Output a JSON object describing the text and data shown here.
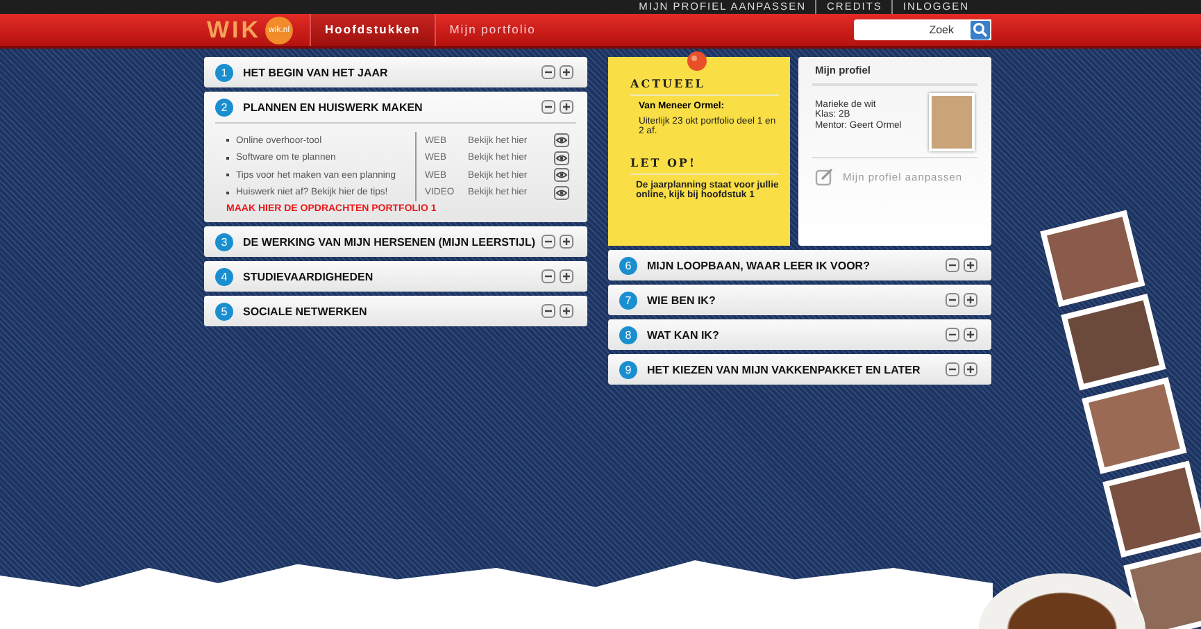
{
  "top_links": [
    "MIJN PROFIEL AANPASSEN",
    "CREDITS",
    "INLOGGEN"
  ],
  "logo": {
    "text": "WIK",
    "badge": "wik.nl"
  },
  "nav": [
    {
      "label": "Hoofdstukken",
      "selected": true
    },
    {
      "label": "Mijn portfolio",
      "selected": false
    }
  ],
  "search": {
    "placeholder": "Zoek"
  },
  "chapters_left": [
    {
      "number": "1",
      "title": "HET BEGIN VAN HET JAAR"
    },
    {
      "number": "2",
      "title": "PLANNEN EN HUISWERK MAKEN",
      "items": [
        {
          "text": "Online overhoor-tool",
          "type": "WEB",
          "link": "Bekijk het hier"
        },
        {
          "text": "Software om te plannen",
          "type": "WEB",
          "link": "Bekijk het hier"
        },
        {
          "text": "Tips voor het maken van een planning",
          "type": "WEB",
          "link": "Bekijk het hier"
        },
        {
          "text": "Huiswerk niet af? Bekijk hier de tips!",
          "type": "VIDEO",
          "link": "Bekijk het hier"
        }
      ],
      "assignment": "MAAK HIER DE OPDRACHTEN PORTFOLIO 1"
    },
    {
      "number": "3",
      "title": "DE WERKING VAN MIJN HERSENEN (MIJN LEERSTIJL)"
    },
    {
      "number": "4",
      "title": "STUDIEVAARDIGHEDEN"
    },
    {
      "number": "5",
      "title": "SOCIALE NETWERKEN"
    }
  ],
  "note": {
    "sections": [
      {
        "heading": "ACTUEEL",
        "subheading": "Van Meneer Ormel:",
        "text": "Uiterlijk 23 okt portfolio deel 1 en 2 af."
      },
      {
        "heading": "LET OP!",
        "text": "De jaarplanning staat voor jullie online, kijk bij hoofdstuk 1"
      }
    ]
  },
  "profile": {
    "title": "Mijn profiel",
    "lines": [
      "Marieke de wit",
      "Klas: 2B",
      "Mentor: Geert Ormel"
    ],
    "edit_link": "Mijn profiel aanpassen"
  },
  "chapters_right": [
    {
      "number": "6",
      "title": "MIJN LOOPBAAN, WAAR LEER IK VOOR?"
    },
    {
      "number": "7",
      "title": "WIE BEN IK?"
    },
    {
      "number": "8",
      "title": "WAT KAN IK?"
    },
    {
      "number": "9",
      "title": "HET KIEZEN VAN MIJN VAKKENPAKKET EN LATER"
    }
  ]
}
